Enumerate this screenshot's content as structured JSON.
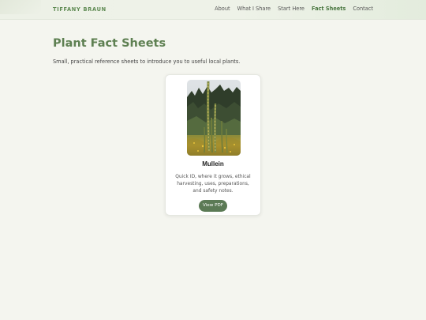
{
  "header": {
    "brand": "TIFFANY BRAUN",
    "nav": [
      {
        "label": "About",
        "active": false
      },
      {
        "label": "What I Share",
        "active": false
      },
      {
        "label": "Start Here",
        "active": false
      },
      {
        "label": "Fact Sheets",
        "active": true
      },
      {
        "label": "Contact",
        "active": false
      }
    ]
  },
  "main": {
    "title": "Plant Fact Sheets",
    "subtitle": "Small, practical reference sheets to introduce you to useful local plants.",
    "cards": [
      {
        "title": "Mullein",
        "description": "Quick ID, where it grows, ethical harvesting, uses, preparations, and safety notes.",
        "button_label": "View PDF",
        "image": "mullein-stalk-photo"
      }
    ]
  },
  "colors": {
    "accent": "#5e8a52",
    "button": "#5b7a55",
    "background": "#f4f5ef"
  }
}
